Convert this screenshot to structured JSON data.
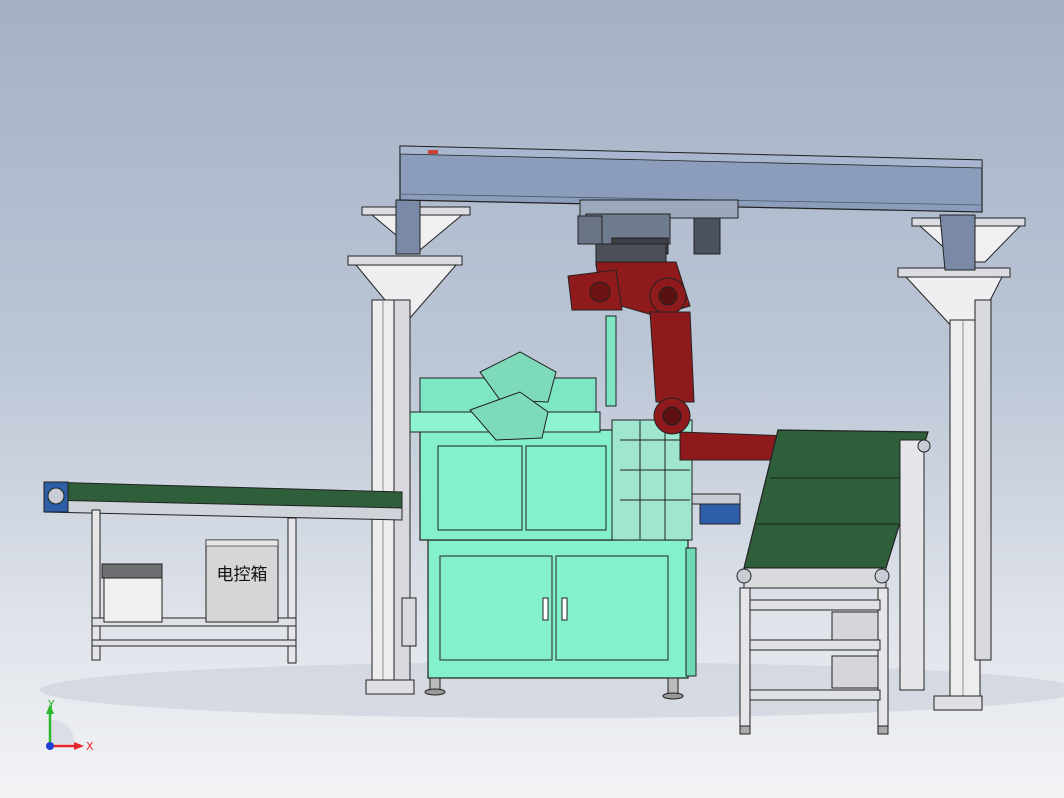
{
  "view": {
    "background_top": "#a4b0c5",
    "background_bottom": "#f2f3f5"
  },
  "labels": {
    "control_box": "电控箱"
  },
  "triad": {
    "x_label": "X",
    "y_label": "Y",
    "x_color": "#e8262a",
    "y_color": "#2cb82c",
    "z_color": "#1b3fd1"
  },
  "colors": {
    "robot_red": "#8f1a1c",
    "machine_teal": "#84f0cc",
    "gantry_blue": "#8b9dbb",
    "belt_green": "#2f5e3a",
    "frame_light": "#e6e6ea"
  }
}
